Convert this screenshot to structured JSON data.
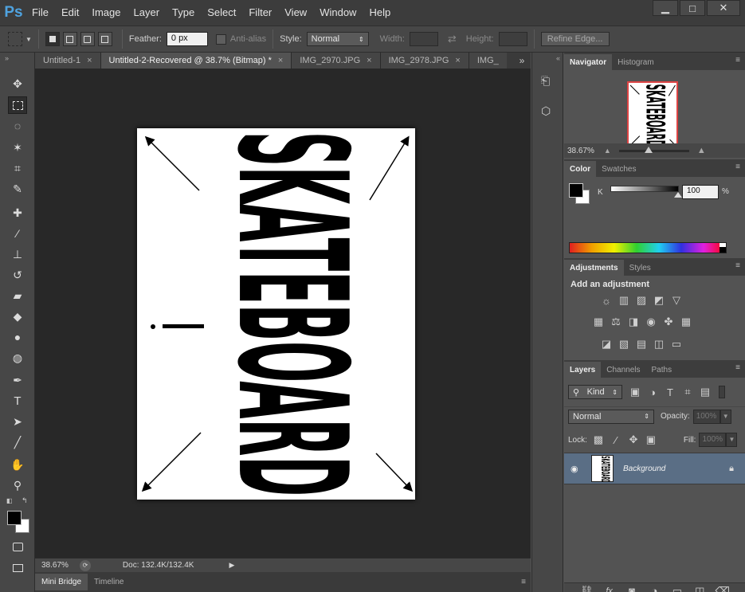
{
  "app": {
    "logo": "Ps"
  },
  "menu": [
    "File",
    "Edit",
    "Image",
    "Layer",
    "Type",
    "Select",
    "Filter",
    "View",
    "Window",
    "Help"
  ],
  "window_controls": {
    "minimize": "▁",
    "maximize": "□",
    "close": "✕"
  },
  "options_bar": {
    "feather_label": "Feather:",
    "feather_value": "0 px",
    "antialias_label": "Anti-alias",
    "style_label": "Style:",
    "style_value": "Normal",
    "width_label": "Width:",
    "height_label": "Height:",
    "refine_edge": "Refine Edge..."
  },
  "doc_tabs": [
    {
      "label": "Untitled-1",
      "close": "×"
    },
    {
      "label": "Untitled-2-Recovered @ 38.7% (Bitmap) *",
      "close": "×"
    },
    {
      "label": "IMG_2970.JPG",
      "close": "×"
    },
    {
      "label": "IMG_2978.JPG",
      "close": "×"
    },
    {
      "label": "IMG_"
    }
  ],
  "tab_overflow": "»",
  "canvas_text": "SKATEBOARD",
  "status": {
    "zoom": "38.67%",
    "doc": "Doc: 132.4K/132.4K"
  },
  "bottom_tabs": [
    "Mini Bridge",
    "Timeline"
  ],
  "navigator": {
    "tabs": [
      "Navigator",
      "Histogram"
    ],
    "zoom": "38.67%"
  },
  "color_panel": {
    "tabs": [
      "Color",
      "Swatches"
    ],
    "channel": "K",
    "value": "100",
    "unit": "%",
    "slider_level_percent": 100
  },
  "adjustments": {
    "tabs": [
      "Adjustments",
      "Styles"
    ],
    "heading": "Add an adjustment"
  },
  "layers": {
    "tabs": [
      "Layers",
      "Channels",
      "Paths"
    ],
    "filter_kind": "Kind",
    "blend_mode": "Normal",
    "opacity_label": "Opacity:",
    "opacity_value": "100%",
    "lock_label": "Lock:",
    "fill_label": "Fill:",
    "fill_value": "100%",
    "layer_name": "Background"
  },
  "colors": {
    "foreground": "#000000",
    "background": "#ffffff",
    "selected_layer": "#5a6e85",
    "accent_logo": "#4fa3e0"
  }
}
